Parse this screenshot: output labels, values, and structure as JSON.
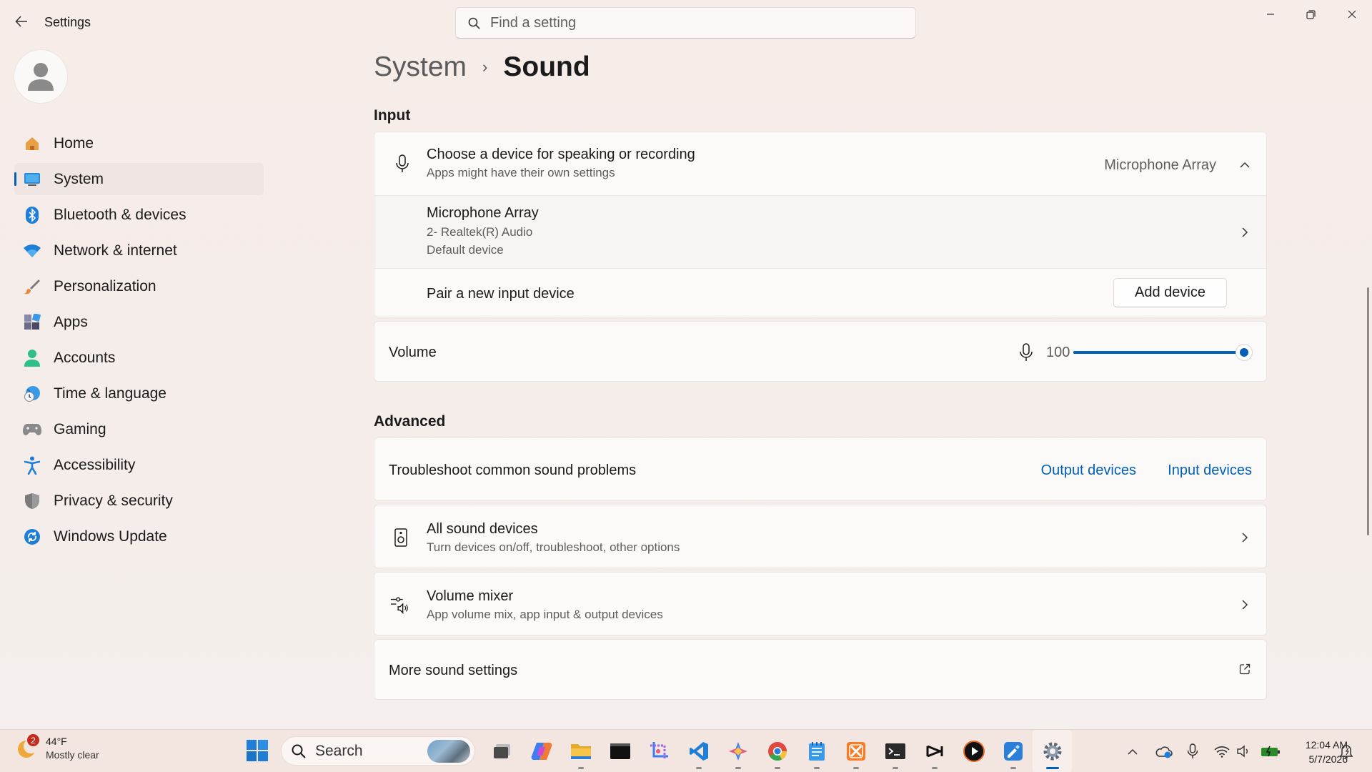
{
  "window": {
    "title": "Settings",
    "search_placeholder": "Find a setting"
  },
  "sidebar": {
    "items": [
      {
        "label": "Home",
        "icon": "home-icon"
      },
      {
        "label": "System",
        "icon": "system-icon",
        "active": true
      },
      {
        "label": "Bluetooth & devices",
        "icon": "bluetooth-icon"
      },
      {
        "label": "Network & internet",
        "icon": "wifi-icon"
      },
      {
        "label": "Personalization",
        "icon": "brush-icon"
      },
      {
        "label": "Apps",
        "icon": "apps-icon"
      },
      {
        "label": "Accounts",
        "icon": "accounts-icon"
      },
      {
        "label": "Time & language",
        "icon": "globe-clock-icon"
      },
      {
        "label": "Gaming",
        "icon": "gamepad-icon"
      },
      {
        "label": "Accessibility",
        "icon": "accessibility-icon"
      },
      {
        "label": "Privacy & security",
        "icon": "shield-icon"
      },
      {
        "label": "Windows Update",
        "icon": "update-icon"
      }
    ]
  },
  "breadcrumb": {
    "parent": "System",
    "separator": "›",
    "current": "Sound"
  },
  "input_section": {
    "heading": "Input",
    "choose_device": {
      "title": "Choose a device for speaking or recording",
      "subtitle": "Apps might have their own settings",
      "selected": "Microphone Array"
    },
    "device": {
      "name": "Microphone Array",
      "line1": "2- Realtek(R) Audio",
      "line2": "Default device"
    },
    "pair": {
      "label": "Pair a new input device",
      "button": "Add device"
    },
    "volume": {
      "label": "Volume",
      "value": "100",
      "level_percent": 100
    }
  },
  "advanced_section": {
    "heading": "Advanced",
    "troubleshoot": {
      "label": "Troubleshoot common sound problems",
      "link_output": "Output devices",
      "link_input": "Input devices"
    },
    "all_devices": {
      "title": "All sound devices",
      "subtitle": "Turn devices on/off, troubleshoot, other options"
    },
    "mixer": {
      "title": "Volume mixer",
      "subtitle": "App volume mix, app input & output devices"
    },
    "more": {
      "label": "More sound settings"
    }
  },
  "taskbar": {
    "weather": {
      "badge": "2",
      "temp": "44°F",
      "condition": "Mostly clear"
    },
    "search_label": "Search",
    "clock": {
      "time": "12:04 AM",
      "date": "5/7/2026"
    },
    "apps": [
      "task-view-icon",
      "copilot-icon",
      "file-explorer-icon",
      "terminal-icon",
      "snipping-tool-icon",
      "vscode-icon",
      "gemini-icon",
      "chrome-icon",
      "notepad-icon",
      "xampp-icon",
      "cmd-icon",
      "capcut-icon",
      "media-player-icon",
      "whiteboard-icon",
      "settings-icon"
    ]
  },
  "colors": {
    "accent": "#005fb8",
    "background": "#f6ece8",
    "card": "#fbfaf9"
  }
}
